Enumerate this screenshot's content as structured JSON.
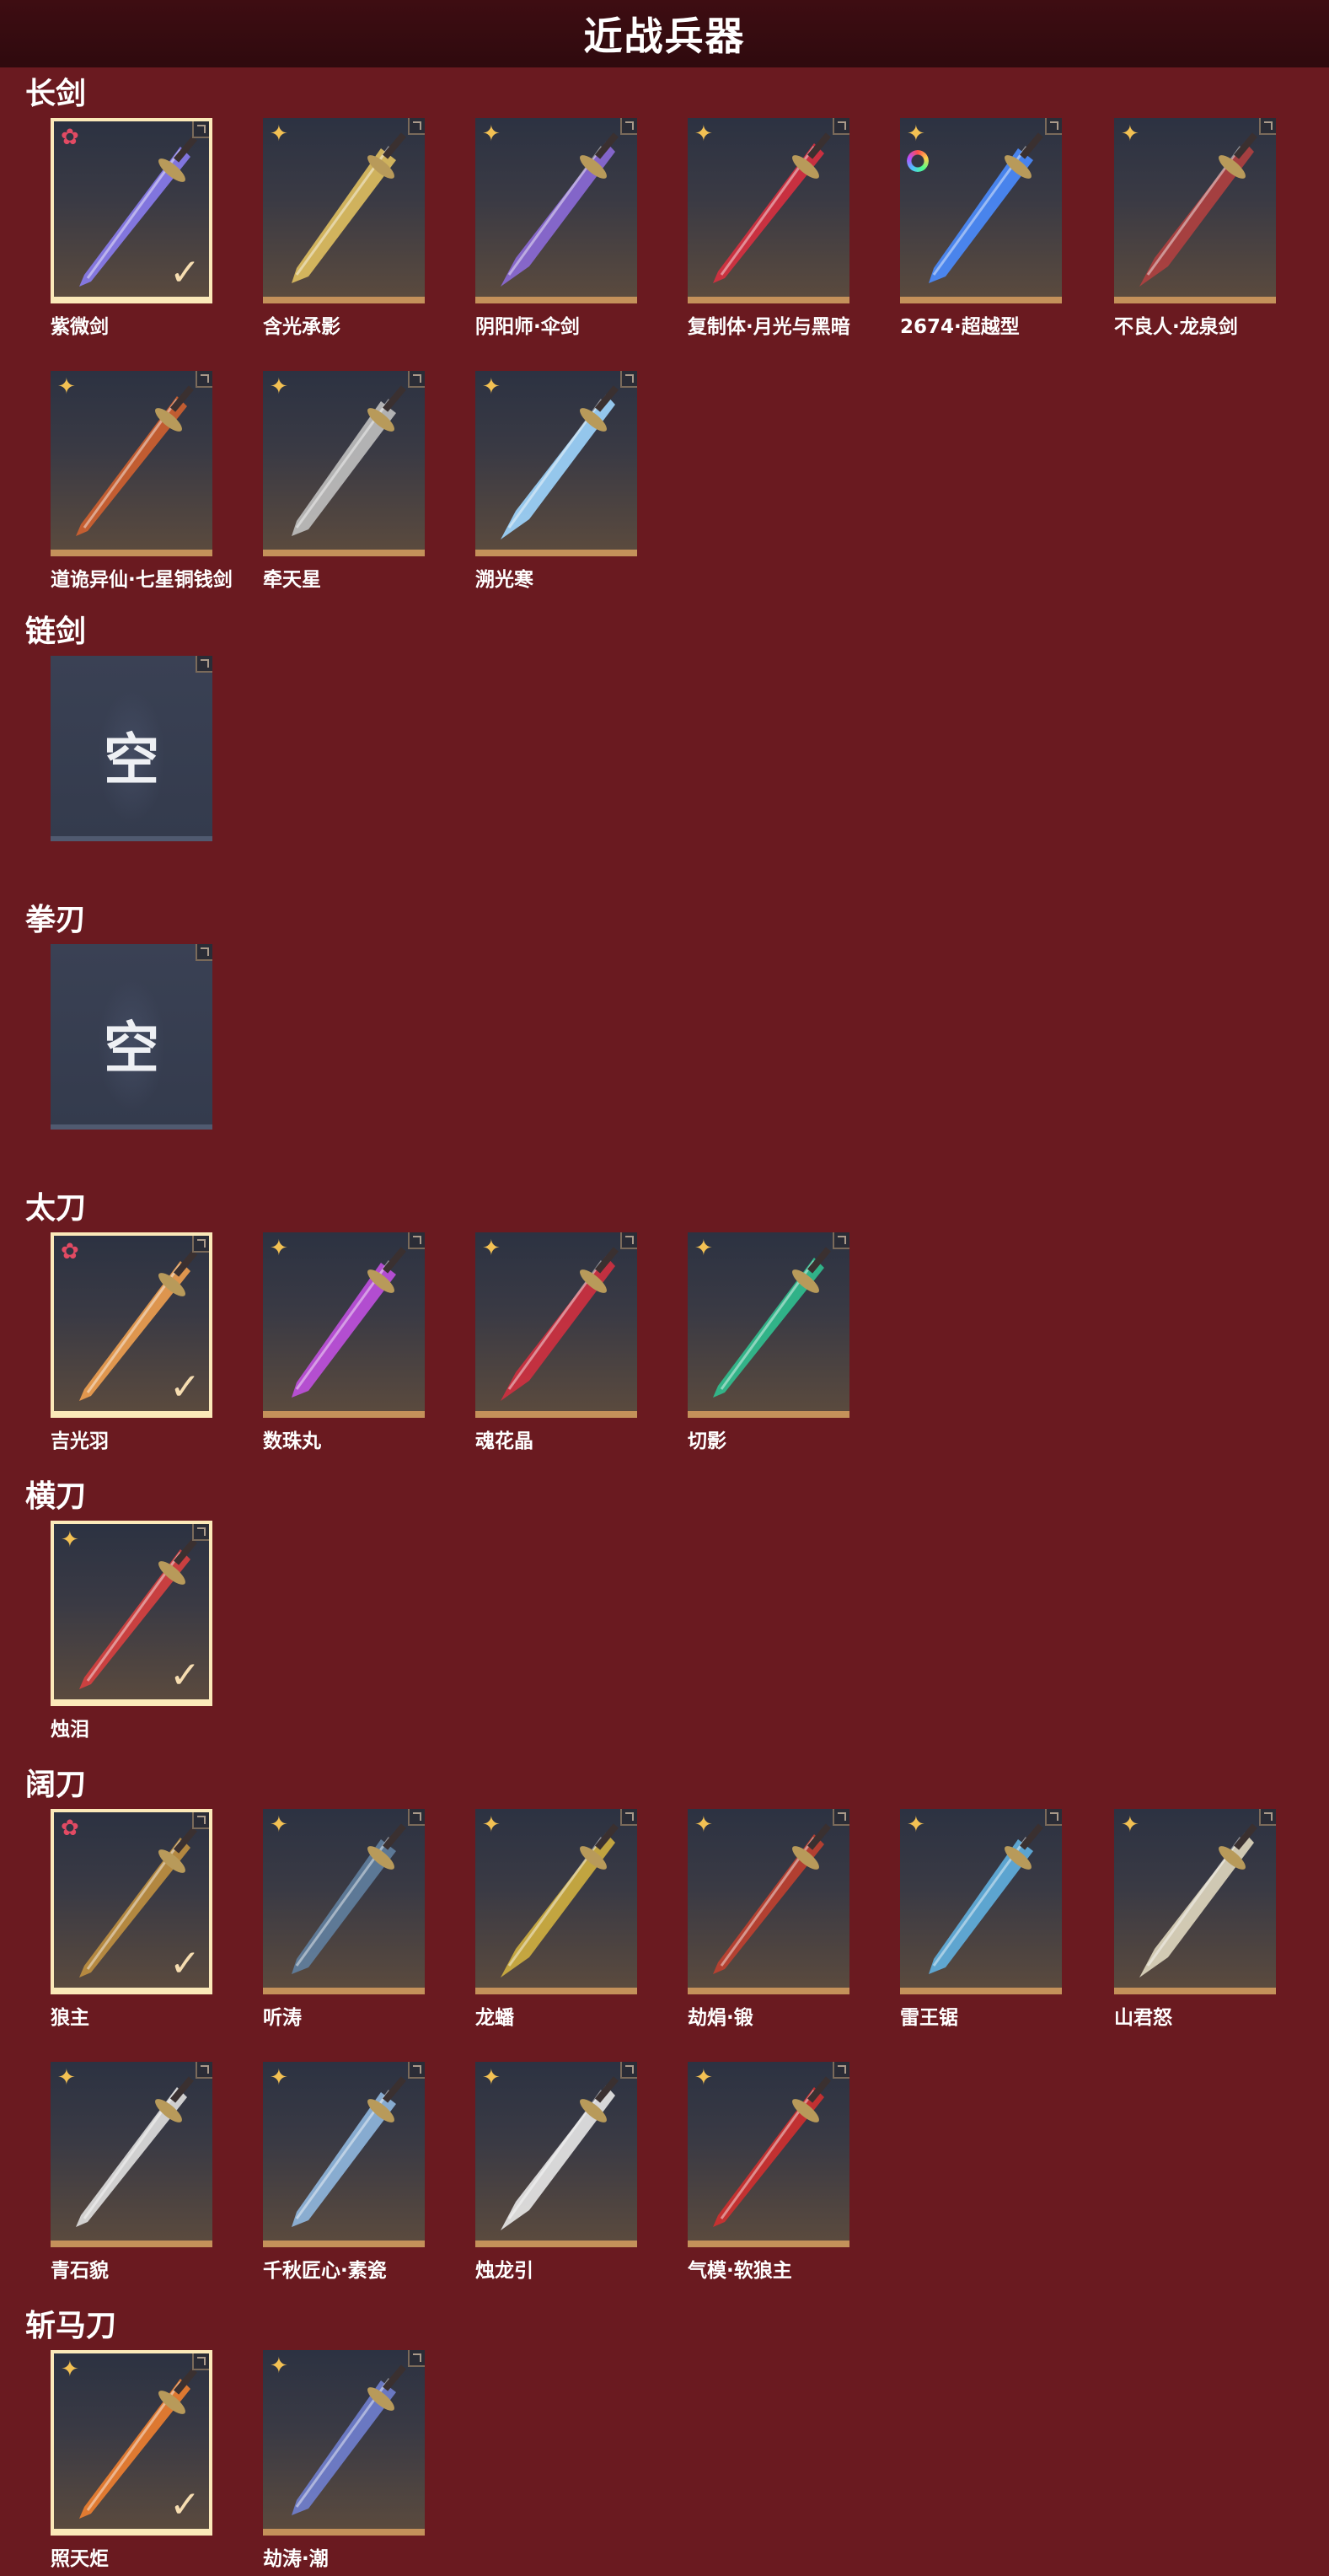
{
  "page": {
    "title": "近战兵器"
  },
  "colors": {
    "background": "#6a1a20",
    "header": "#320a0f",
    "card_border_gold": "#c4915a",
    "equipped_border": "#fbe9b9",
    "rarity_gold": "#f3c153",
    "rarity_red": "#e24a63"
  },
  "sections": [
    {
      "title": "长剑",
      "items": [
        {
          "label": "紫微剑",
          "rarity": "red",
          "equipped": true,
          "weapon_color": "#8a7cf0"
        },
        {
          "label": "含光承影",
          "rarity": "gold",
          "equipped": false,
          "weapon_color": "#e0c060"
        },
        {
          "label": "阴阳师·伞剑",
          "rarity": "gold",
          "equipped": false,
          "weapon_color": "#8c6ad8"
        },
        {
          "label": "复制体·月光与黑暗",
          "rarity": "gold",
          "equipped": false,
          "weapon_color": "#d83040"
        },
        {
          "label": "2674·超越型",
          "rarity": "gold",
          "equipped": false,
          "weapon_color": "#4a8cff",
          "ring": true
        },
        {
          "label": "不良人·龙泉剑",
          "rarity": "gold",
          "equipped": false,
          "weapon_color": "#b04040"
        },
        {
          "label": "道诡异仙·七星铜钱剑",
          "rarity": "gold",
          "equipped": false,
          "weapon_color": "#d06030"
        },
        {
          "label": "牵天星",
          "rarity": "gold",
          "equipped": false,
          "weapon_color": "#c0c0c0"
        },
        {
          "label": "溯光寒",
          "rarity": "gold",
          "equipped": false,
          "weapon_color": "#9fd6ff"
        }
      ]
    },
    {
      "title": "链剑",
      "items": [
        {
          "label": "",
          "empty": true,
          "empty_text": "空"
        }
      ]
    },
    {
      "title": "拳刃",
      "items": [
        {
          "label": "",
          "empty": true,
          "empty_text": "空"
        }
      ]
    },
    {
      "title": "太刀",
      "items": [
        {
          "label": "吉光羽",
          "rarity": "red",
          "equipped": true,
          "weapon_color": "#f0a050"
        },
        {
          "label": "数珠丸",
          "rarity": "gold",
          "equipped": false,
          "weapon_color": "#c050e0"
        },
        {
          "label": "魂花晶",
          "rarity": "gold",
          "equipped": false,
          "weapon_color": "#d03040"
        },
        {
          "label": "切影",
          "rarity": "gold",
          "equipped": false,
          "weapon_color": "#30c090"
        }
      ]
    },
    {
      "title": "横刀",
      "items": [
        {
          "label": "烛泪",
          "rarity": "gold",
          "equipped": true,
          "weapon_color": "#d84040"
        }
      ]
    },
    {
      "title": "阔刀",
      "items": [
        {
          "label": "狼主",
          "rarity": "red",
          "equipped": true,
          "weapon_color": "#c09040"
        },
        {
          "label": "听涛",
          "rarity": "gold",
          "equipped": false,
          "weapon_color": "#6080a0"
        },
        {
          "label": "龙蟠",
          "rarity": "gold",
          "equipped": false,
          "weapon_color": "#d0b040"
        },
        {
          "label": "劫焆·锻",
          "rarity": "gold",
          "equipped": false,
          "weapon_color": "#c04030"
        },
        {
          "label": "雷王锯",
          "rarity": "gold",
          "equipped": false,
          "weapon_color": "#60b0e0"
        },
        {
          "label": "山君怒",
          "rarity": "gold",
          "equipped": false,
          "weapon_color": "#e0d8c0"
        },
        {
          "label": "青石貌",
          "rarity": "gold",
          "equipped": false,
          "weapon_color": "#e0e0e0"
        },
        {
          "label": "千秋匠心·素瓷",
          "rarity": "gold",
          "equipped": false,
          "weapon_color": "#90b8e0"
        },
        {
          "label": "烛龙引",
          "rarity": "gold",
          "equipped": false,
          "weapon_color": "#e8e8e8"
        },
        {
          "label": "气模·软狼主",
          "rarity": "gold",
          "equipped": false,
          "weapon_color": "#d03030"
        }
      ]
    },
    {
      "title": "斩马刀",
      "items": [
        {
          "label": "照天炬",
          "rarity": "gold",
          "equipped": true,
          "weapon_color": "#f08030"
        },
        {
          "label": "劫涛·潮",
          "rarity": "gold",
          "equipped": false,
          "weapon_color": "#7080d0"
        }
      ]
    }
  ],
  "icons": {
    "rarity": "rarity-star-icon",
    "equipped": "check-icon",
    "corner": "corner-tab-icon",
    "skin_variant": "color-ring-icon"
  }
}
